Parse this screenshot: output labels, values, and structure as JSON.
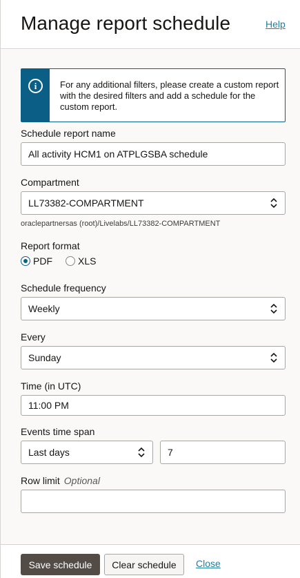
{
  "header": {
    "title": "Manage report schedule",
    "help_label": "Help"
  },
  "info": {
    "text": "For any additional filters, please create a custom report with the desired filters and add a schedule for the custom report."
  },
  "form": {
    "schedule_name": {
      "label": "Schedule report name",
      "value": "All activity HCM1 on ATPLGSBA schedule"
    },
    "compartment": {
      "label": "Compartment",
      "value": "LL73382-COMPARTMENT",
      "path": "oraclepartnersas (root)/Livelabs/LL73382-COMPARTMENT"
    },
    "report_format": {
      "label": "Report format",
      "options": [
        "PDF",
        "XLS"
      ],
      "selected": "PDF"
    },
    "schedule_frequency": {
      "label": "Schedule frequency",
      "value": "Weekly"
    },
    "every": {
      "label": "Every",
      "value": "Sunday"
    },
    "time": {
      "label": "Time (in UTC)",
      "value": "11:00 PM"
    },
    "events_time_span": {
      "label": "Events time span",
      "unit_value": "Last days",
      "amount": "7"
    },
    "row_limit": {
      "label": "Row limit",
      "optional_label": "Optional",
      "value": ""
    }
  },
  "footer": {
    "save_label": "Save schedule",
    "clear_label": "Clear schedule",
    "close_label": "Close"
  },
  "colors": {
    "accent": "#0b5f86",
    "link": "#227e9e",
    "primary_button": "#524b46"
  }
}
